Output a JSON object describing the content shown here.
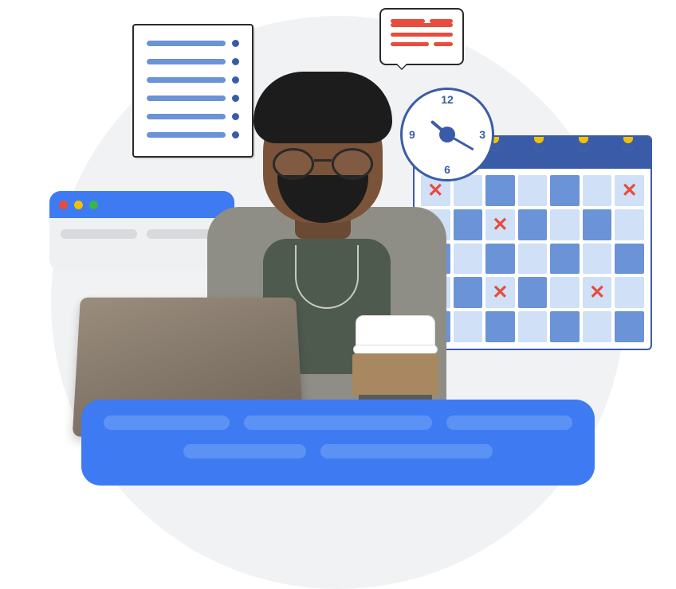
{
  "clock": {
    "n12": "12",
    "n3": "3",
    "n6": "6",
    "n9": "9"
  },
  "calendar": {
    "cells": [
      {
        "dark": false,
        "x": true
      },
      {
        "dark": false
      },
      {
        "dark": true
      },
      {
        "dark": false
      },
      {
        "dark": true
      },
      {
        "dark": false
      },
      {
        "dark": false,
        "x": true
      },
      {
        "dark": false
      },
      {
        "dark": true
      },
      {
        "dark": false,
        "x": true
      },
      {
        "dark": true
      },
      {
        "dark": false
      },
      {
        "dark": true
      },
      {
        "dark": false
      },
      {
        "dark": true
      },
      {
        "dark": false
      },
      {
        "dark": true
      },
      {
        "dark": false
      },
      {
        "dark": true
      },
      {
        "dark": false
      },
      {
        "dark": true
      },
      {
        "dark": false
      },
      {
        "dark": true
      },
      {
        "dark": false,
        "x": true
      },
      {
        "dark": true
      },
      {
        "dark": false
      },
      {
        "dark": false,
        "x": true
      },
      {
        "dark": false
      },
      {
        "dark": true
      },
      {
        "dark": false
      },
      {
        "dark": true
      },
      {
        "dark": false
      },
      {
        "dark": true
      },
      {
        "dark": false
      },
      {
        "dark": true
      }
    ]
  },
  "browser": {
    "traffic_lights": [
      "#e84c3d",
      "#f2c200",
      "#3bb54a"
    ]
  }
}
